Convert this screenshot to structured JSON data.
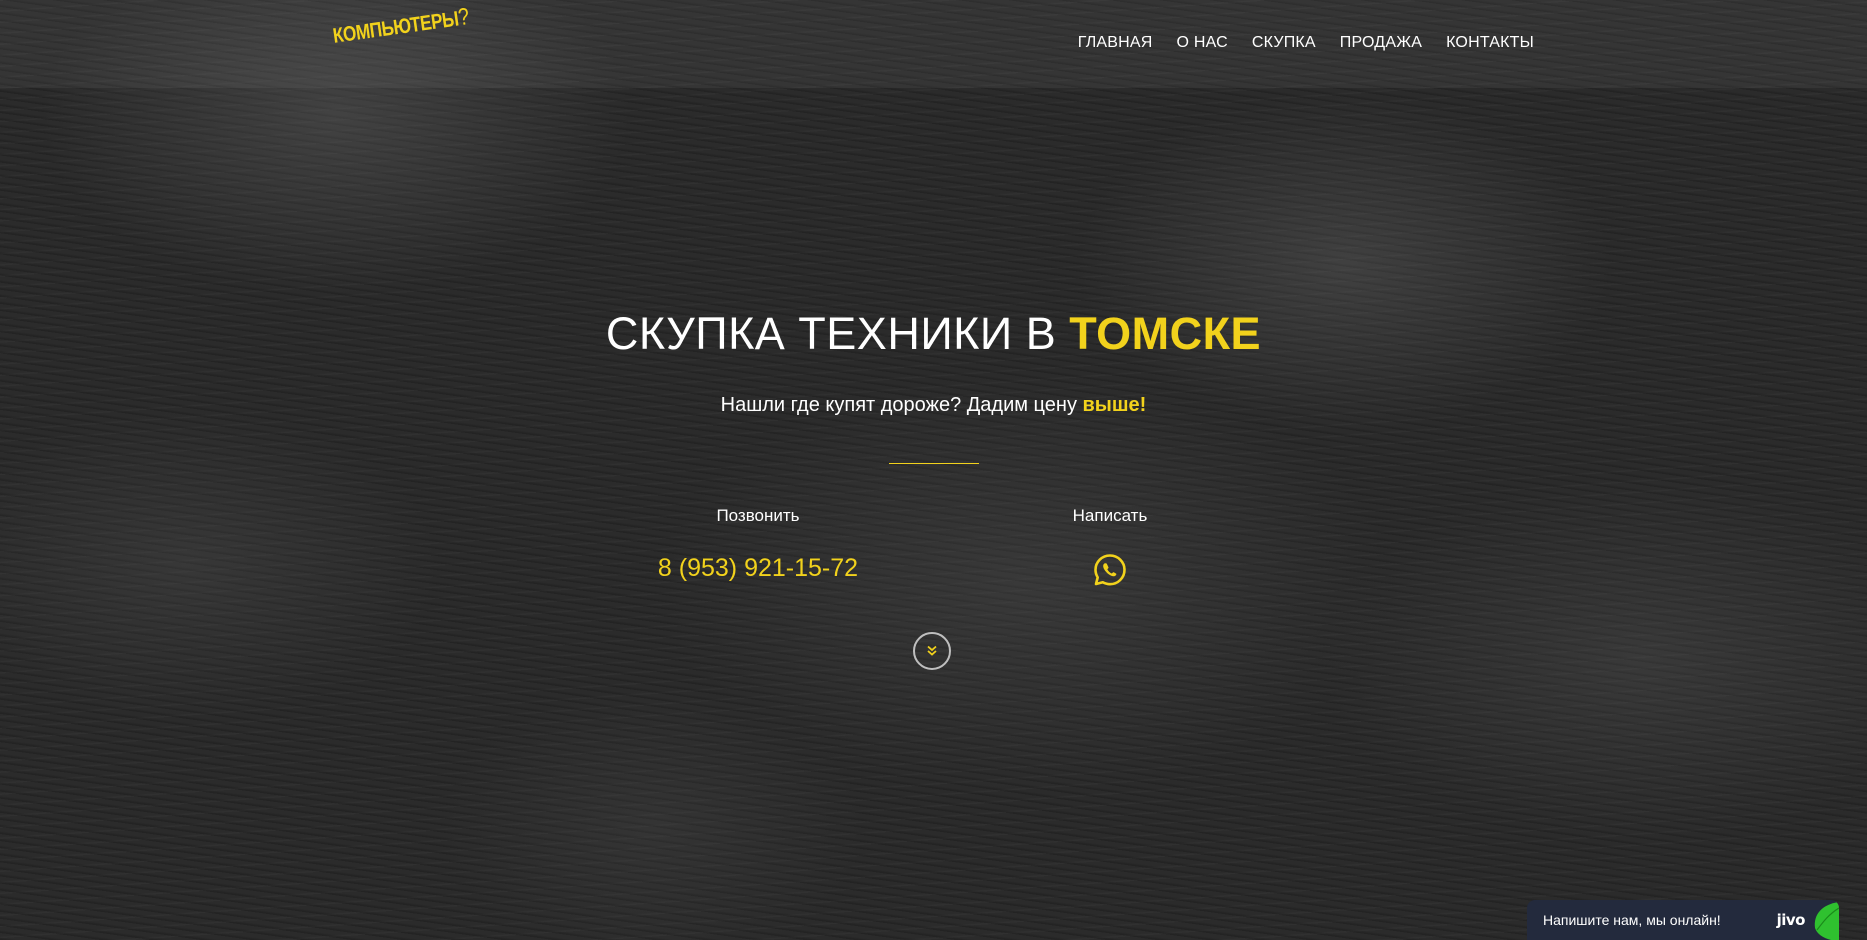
{
  "header": {
    "logo": {
      "text": "КОМПЬЮТЕРЫ",
      "mark": "?"
    },
    "nav": [
      {
        "label": "ГЛАВНАЯ"
      },
      {
        "label": "О НАС"
      },
      {
        "label": "СКУПКА"
      },
      {
        "label": "ПРОДАЖА"
      },
      {
        "label": "КОНТАКТЫ"
      }
    ]
  },
  "hero": {
    "title_main": "СКУПКА ТЕХНИКИ В ",
    "title_accent": "ТОМСКЕ",
    "subtitle_main": "Нашли где купят дороже? Дадим цену ",
    "subtitle_accent": "выше!"
  },
  "contacts": {
    "call": {
      "label": "Позвонить",
      "phone": "8 (953) 921-15-72"
    },
    "write": {
      "label": "Написать",
      "icon": "whatsapp-icon"
    }
  },
  "scroll": {
    "icon": "double-chevron-down-icon"
  },
  "chat": {
    "text": "Напишите нам, мы онлайн!",
    "brand": "jivo",
    "icon": "leaf-icon"
  },
  "colors": {
    "accent": "#f2d21c",
    "background": "#2b2b2b",
    "chat_bg": "#232a3d",
    "chat_leaf": "#2fc12f"
  }
}
